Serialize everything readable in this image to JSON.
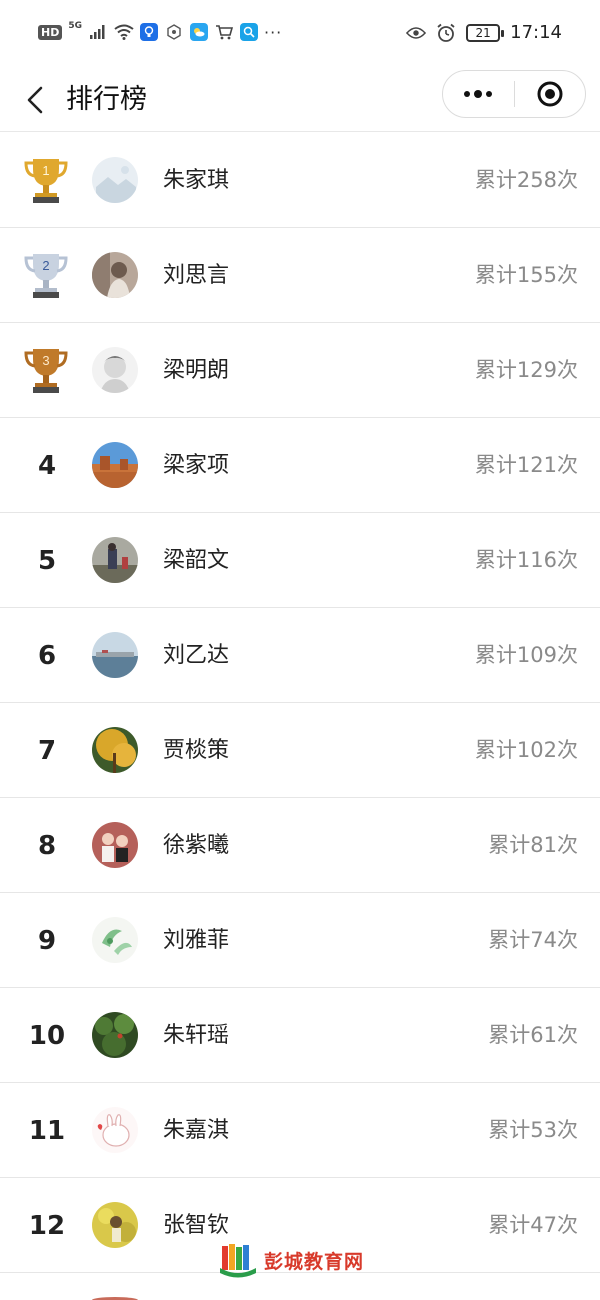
{
  "status_bar": {
    "hd": "HD",
    "network": "5G",
    "time": "17:14",
    "battery": "21",
    "more": "···"
  },
  "nav": {
    "title": "排行榜",
    "icons": {
      "back": "chevron-left-icon",
      "more": "more-dots-icon",
      "close": "target-icon"
    }
  },
  "ranking": [
    {
      "rank": "1",
      "trophy": "gold",
      "name": "朱家琪",
      "count": "累计258次"
    },
    {
      "rank": "2",
      "trophy": "silver",
      "name": "刘思言",
      "count": "累计155次"
    },
    {
      "rank": "3",
      "trophy": "bronze",
      "name": "梁明朗",
      "count": "累计129次"
    },
    {
      "rank": "4",
      "name": "梁家项",
      "count": "累计121次"
    },
    {
      "rank": "5",
      "name": "梁韶文",
      "count": "累计116次"
    },
    {
      "rank": "6",
      "name": "刘乙达",
      "count": "累计109次"
    },
    {
      "rank": "7",
      "name": "贾棪策",
      "count": "累计102次"
    },
    {
      "rank": "8",
      "name": "徐紫曦",
      "count": "累计81次"
    },
    {
      "rank": "9",
      "name": "刘雅菲",
      "count": "累计74次"
    },
    {
      "rank": "10",
      "name": "朱轩瑶",
      "count": "累计61次"
    },
    {
      "rank": "11",
      "name": "朱嘉淇",
      "count": "累计53次"
    },
    {
      "rank": "12",
      "name": "张智钦",
      "count": "累计47次"
    }
  ],
  "watermark": {
    "text": "彭城教育网"
  },
  "colors": {
    "gold": "#e0a82e",
    "silver": "#aeb8c8",
    "bronze": "#c07a2a",
    "count_text": "#8a8a8a",
    "watermark": "#d83a2b"
  }
}
